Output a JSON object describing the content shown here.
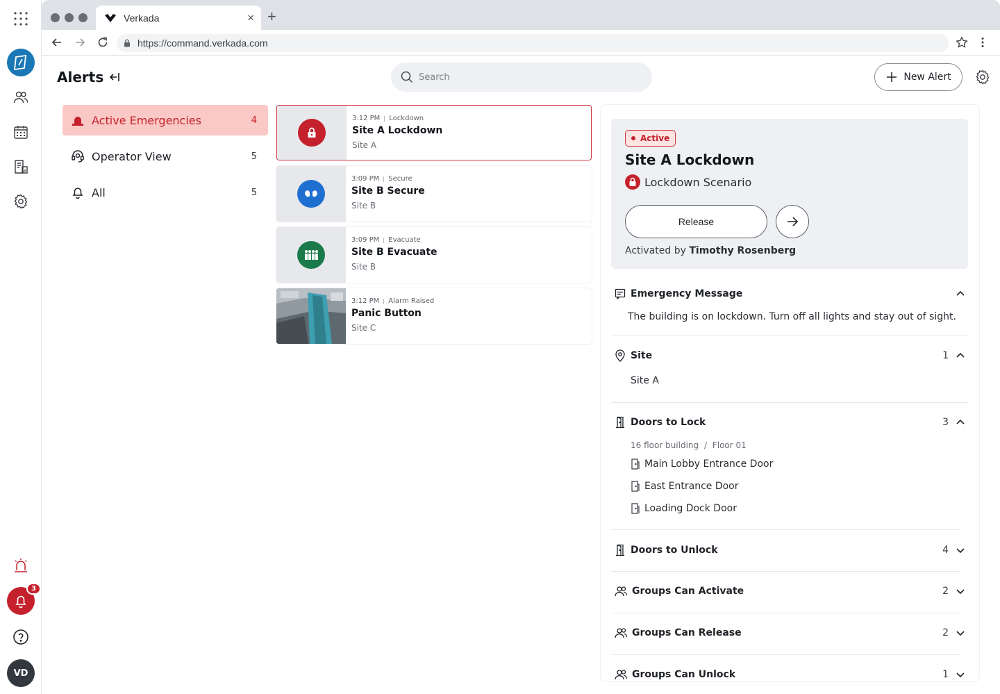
{
  "browser": {
    "tab_title": "Verkada",
    "tab_close": "×",
    "new_tab": "+",
    "url": "https://command.verkada.com"
  },
  "rail": {
    "notification_count": "3",
    "avatar_initials": "VD",
    "brand_color": "#1a78b6",
    "alert_color": "#c4212d"
  },
  "header": {
    "title": "Alerts",
    "search_placeholder": "Search",
    "new_alert_label": "New Alert"
  },
  "filters": [
    {
      "label": "Active Emergencies",
      "count": "4"
    },
    {
      "label": "Operator View",
      "count": "5"
    },
    {
      "label": "All",
      "count": "5"
    }
  ],
  "alerts": [
    {
      "time": "3:12 PM",
      "type": "Lockdown",
      "name": "Site A Lockdown",
      "site": "Site A",
      "icon": "lock-icon",
      "color": "#c4212d"
    },
    {
      "time": "3:09 PM",
      "type": "Secure",
      "name": "Site B Secure",
      "site": "Site B",
      "icon": "hands-icon",
      "color": "#1f6fd1"
    },
    {
      "time": "3:09 PM",
      "type": "Evacuate",
      "name": "Site B Evacuate",
      "site": "Site B",
      "icon": "people-icon",
      "color": "#1b7a4a"
    },
    {
      "time": "3:12 PM",
      "type": "Alarm Raised",
      "name": "Panic Button",
      "site": "Site C",
      "icon": "camera-snapshot"
    }
  ],
  "detail": {
    "status": "Active",
    "title": "Site A Lockdown",
    "scenario": "Lockdown Scenario",
    "release_label": "Release",
    "activated_prefix": "Activated by",
    "activated_by": "Timothy Rosenberg",
    "emergency_message": {
      "title": "Emergency Message",
      "text": "The building is on lockdown. Turn off all lights and stay out of sight."
    },
    "site": {
      "title": "Site",
      "count": "1",
      "value": "Site A"
    },
    "doors_to_lock": {
      "title": "Doors to Lock",
      "count": "3",
      "building": "16 floor building",
      "crumb_sep": "/",
      "floor": "Floor 01",
      "doors": [
        "Main Lobby Entrance Door",
        "East Entrance Door",
        "Loading Dock Door"
      ]
    },
    "doors_to_unlock": {
      "title": "Doors to Unlock",
      "count": "4"
    },
    "groups_activate": {
      "title": "Groups Can Activate",
      "count": "2"
    },
    "groups_release": {
      "title": "Groups Can Release",
      "count": "2"
    },
    "groups_unlock": {
      "title": "Groups Can Unlock",
      "count": "1"
    }
  }
}
